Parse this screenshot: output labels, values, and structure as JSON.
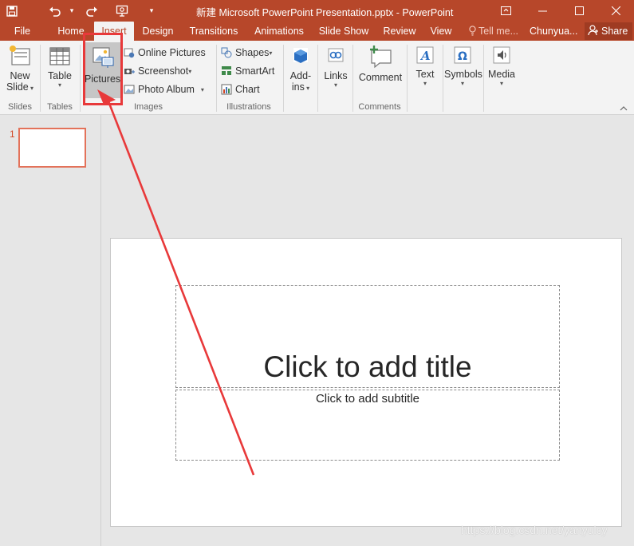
{
  "window": {
    "title": "新建 Microsoft PowerPoint Presentation.pptx - PowerPoint",
    "accent": "#b7472a"
  },
  "qat": {
    "icons": [
      "save-icon",
      "undo-icon",
      "redo-icon",
      "start-slideshow-icon",
      "customize-qat-icon"
    ]
  },
  "tabs": {
    "file": "File",
    "home": "Home",
    "insert": "Insert",
    "design": "Design",
    "transitions": "Transitions",
    "animations": "Animations",
    "slideshow": "Slide Show",
    "review": "Review",
    "view": "View",
    "tell_me": "Tell me...",
    "user": "Chunyua...",
    "share": "Share",
    "active": "Insert"
  },
  "ribbon": {
    "new_slide_1": "New",
    "new_slide_2": "Slide",
    "table": "Table",
    "pictures": "Pictures",
    "online_pictures": "Online Pictures",
    "screenshot": "Screenshot",
    "photo_album": "Photo Album",
    "shapes": "Shapes",
    "smartart": "SmartArt",
    "chart": "Chart",
    "addins_1": "Add-",
    "addins_2": "ins",
    "links": "Links",
    "comment": "Comment",
    "text": "Text",
    "symbols": "Symbols",
    "media": "Media",
    "groups": {
      "slides": "Slides",
      "tables": "Tables",
      "images": "Images",
      "illustrations": "Illustrations",
      "comments": "Comments"
    }
  },
  "thumbnails": {
    "slide_number": "1"
  },
  "slide": {
    "title_placeholder": "Click to add title",
    "subtitle_placeholder": "Click to add subtitle"
  },
  "watermark": "https://blog.csdn.net/yanyulcy",
  "annotation_color": "#e8393a"
}
